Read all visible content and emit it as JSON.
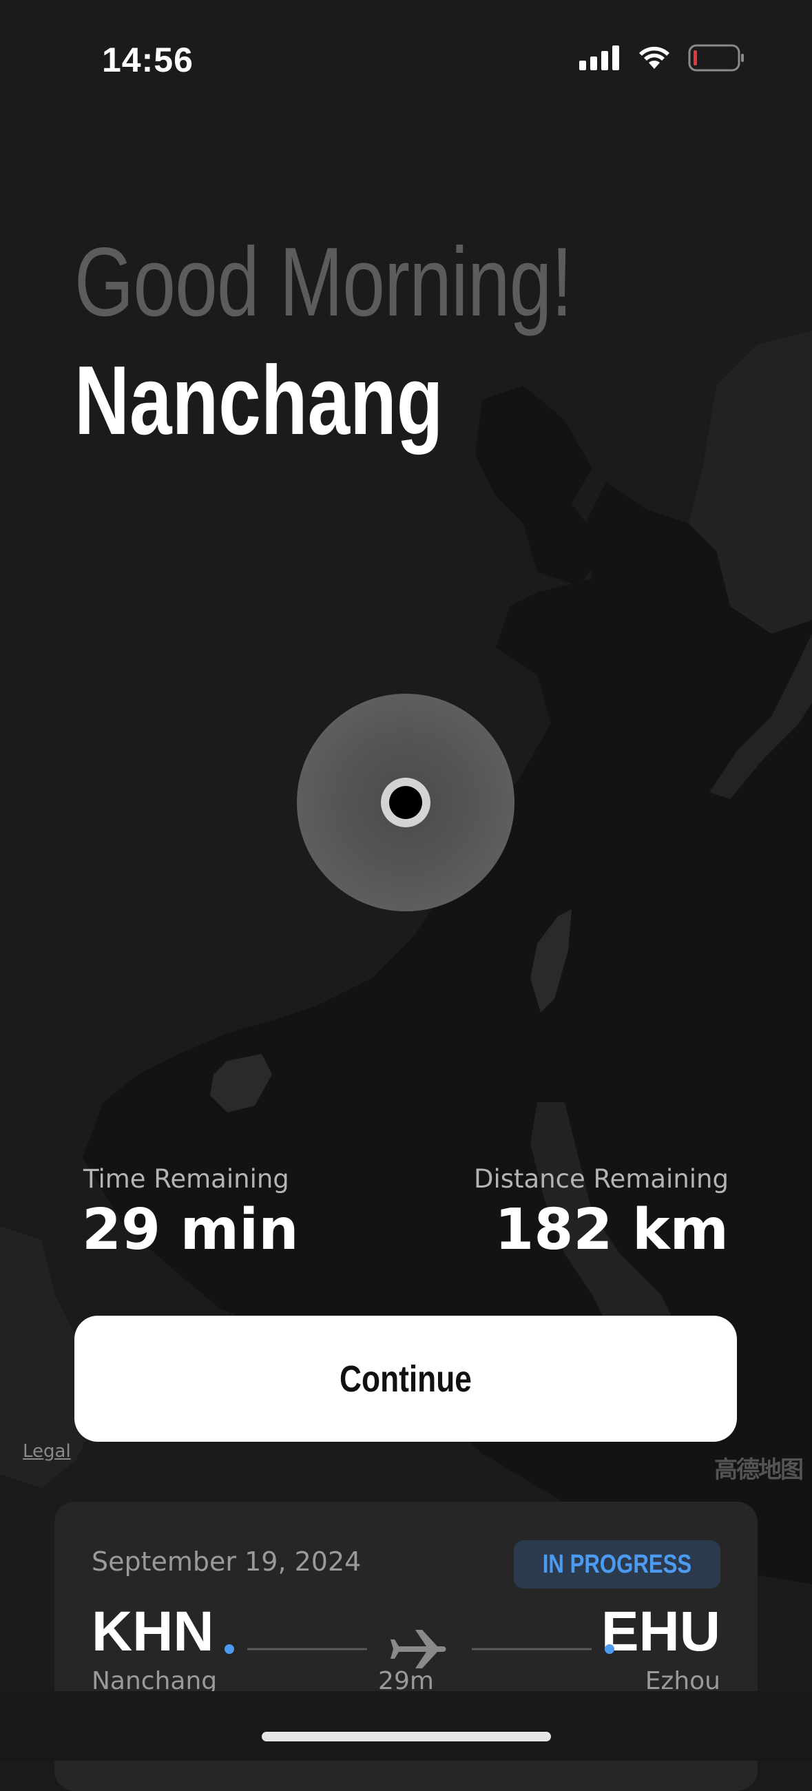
{
  "status_bar": {
    "time": "14:56"
  },
  "header": {
    "greeting": "Good Morning!",
    "city": "Nanchang"
  },
  "stats": {
    "time_label": "Time Remaining",
    "time_value": "29 min",
    "distance_label": "Distance Remaining",
    "distance_value": "182 km"
  },
  "continue_label": "Continue",
  "map": {
    "legal_label": "Legal",
    "provider_logo": "高德地图"
  },
  "flight_card": {
    "date": "September 19, 2024",
    "status": "IN PROGRESS",
    "origin_code": "KHN",
    "origin_city": "Nanchang",
    "destination_code": "EHU",
    "destination_city": "Ezhou",
    "duration": "29m"
  },
  "colors": {
    "accent": "#4d9bf0",
    "background": "#1a1a1a",
    "land": "#2a2a2a",
    "water": "#141414"
  }
}
